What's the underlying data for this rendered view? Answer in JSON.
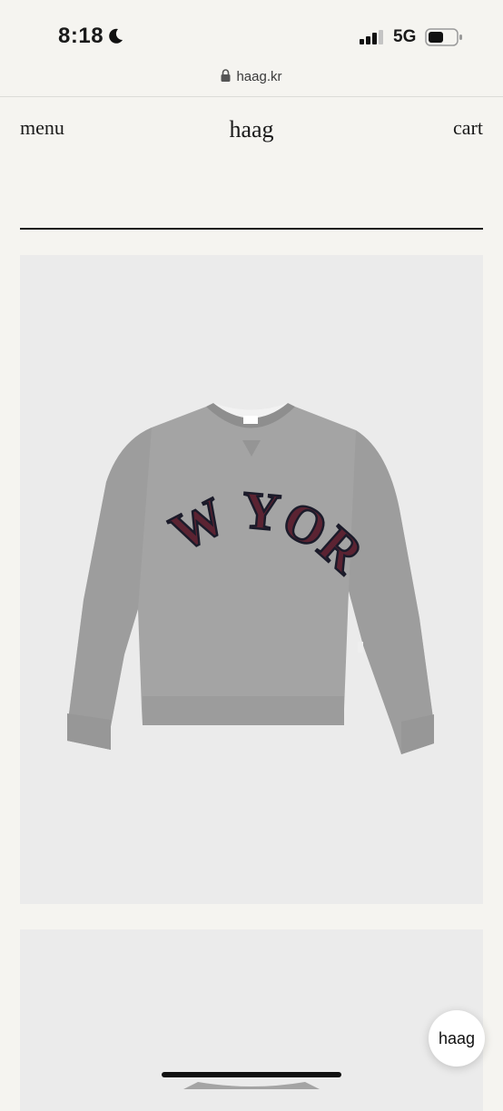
{
  "status_bar": {
    "time": "8:18",
    "network": "5G",
    "icons": [
      "moon-icon",
      "signal-bars-icon",
      "battery-icon"
    ]
  },
  "browser": {
    "url": "haag.kr",
    "lock_icon": "lock-icon"
  },
  "header": {
    "menu_label": "menu",
    "brand": "haag",
    "cart_label": "cart"
  },
  "products": [
    {
      "print_text": "NEW YORK",
      "colors": {
        "background": "#ebebeb",
        "sweatshirt": "#a3a3a3",
        "print_fill": "#5b2332",
        "print_outline": "#1b1b2a"
      }
    },
    {
      "colors": {
        "background": "#ebebeb"
      }
    }
  ],
  "chat_button": {
    "label": "haag"
  },
  "colors": {
    "page_background": "#f5f4f0",
    "text": "#1a1a1a"
  }
}
